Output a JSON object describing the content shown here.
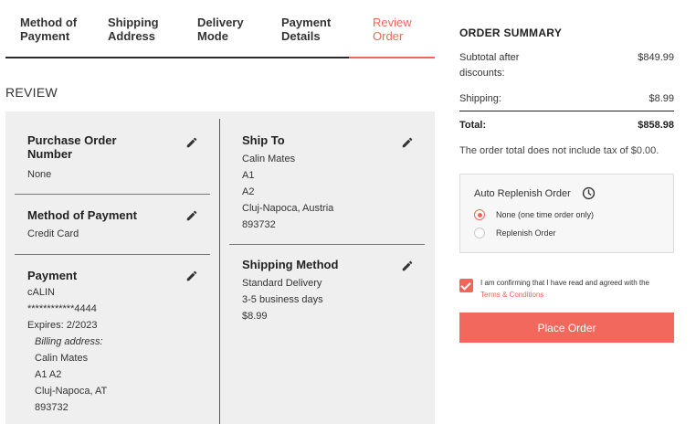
{
  "steps": [
    {
      "line1": "Method of",
      "line2": "Payment"
    },
    {
      "line1": "Shipping",
      "line2": "Address"
    },
    {
      "line1": "Delivery",
      "line2": "Mode"
    },
    {
      "line1": "Payment",
      "line2": "Details"
    },
    {
      "line1": "Review",
      "line2": "Order"
    }
  ],
  "review": {
    "title": "REVIEW",
    "purchase_order": {
      "title_line1": "Purchase Order",
      "title_line2": "Number",
      "value": "None"
    },
    "method_of_payment": {
      "title": "Method of Payment",
      "value": "Credit Card"
    },
    "payment": {
      "title": "Payment",
      "name": "cALIN",
      "card": "************4444",
      "expires": "Expires: 2/2023",
      "billing_label": "Billing address:",
      "billing_name": "Calin Mates",
      "billing_line1": "A1 A2",
      "billing_city": "Cluj-Napoca, AT",
      "billing_zip": "893732"
    },
    "ship_to": {
      "title": "Ship To",
      "name": "Calin Mates",
      "line1": "A1",
      "line2": "A2",
      "city": "Cluj-Napoca, Austria",
      "zip": "893732"
    },
    "shipping_method": {
      "title": "Shipping Method",
      "name": "Standard Delivery",
      "duration": "3-5 business days",
      "price": "$8.99"
    }
  },
  "summary": {
    "title": "ORDER SUMMARY",
    "subtotal_label_line1": "Subtotal after",
    "subtotal_label_line2": "discounts:",
    "subtotal_value": "$849.99",
    "shipping_label": "Shipping:",
    "shipping_value": "$8.99",
    "total_label": "Total:",
    "total_value": "$858.98",
    "tax_note": "The order total does not include tax of $0.00."
  },
  "replenish": {
    "title": "Auto Replenish Order",
    "options": [
      "None (one time order only)",
      "Replenish Order"
    ],
    "selected": "None (one time order only)"
  },
  "terms": {
    "text": "I am confirming that I have read and agreed with the",
    "link": "Terms & Conditions",
    "checked": true
  },
  "place_order_label": "Place Order",
  "colors": {
    "accent": "#f0665a",
    "panel": "#efefef"
  }
}
